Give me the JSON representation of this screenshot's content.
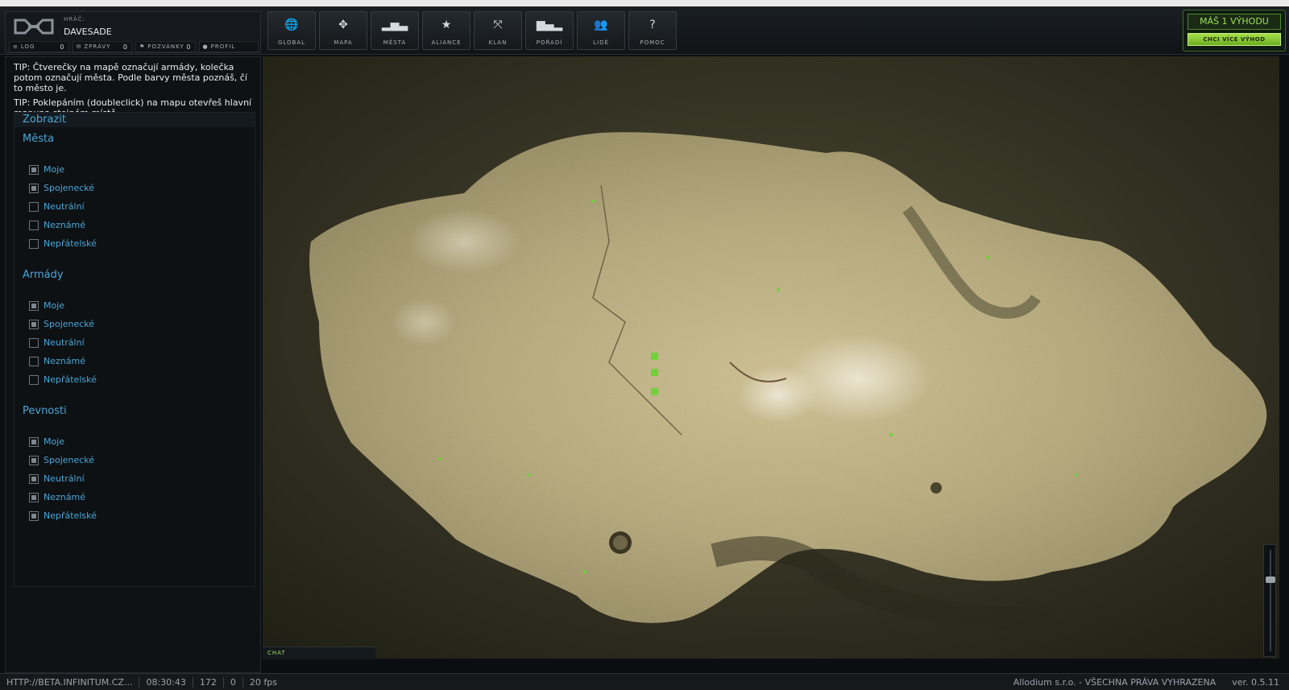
{
  "player": {
    "caption": "HRÁČ:",
    "name": "DAVESADE",
    "links": [
      {
        "label": "LOG",
        "count": "0",
        "icon": "list-icon"
      },
      {
        "label": "ZPRÁVY",
        "count": "0",
        "icon": "mail-icon"
      },
      {
        "label": "POZVÁNKY",
        "count": "0",
        "icon": "invite-icon"
      },
      {
        "label": "PROFIL",
        "count": "",
        "icon": "user-icon"
      }
    ]
  },
  "nav": [
    {
      "label": "GLOBAL",
      "icon": "globe-icon",
      "glyph": "🌐"
    },
    {
      "label": "MAPA",
      "icon": "move-arrows-icon",
      "glyph": "✥"
    },
    {
      "label": "MĚSTA",
      "icon": "buildings-icon",
      "glyph": "▂▅▃"
    },
    {
      "label": "ALIANCE",
      "icon": "star-icon",
      "glyph": "★"
    },
    {
      "label": "KLAN",
      "icon": "expand-icon",
      "glyph": "⤧"
    },
    {
      "label": "POŘADÍ",
      "icon": "ranking-icon",
      "glyph": "▆▄▂"
    },
    {
      "label": "LIDÉ",
      "icon": "people-icon",
      "glyph": "👥"
    },
    {
      "label": "POMOC",
      "icon": "help-icon",
      "glyph": "?"
    }
  ],
  "promo": {
    "title": "MÁŠ 1 VÝHODU",
    "button": "CHCI VÍCE VÝHOD"
  },
  "tips": {
    "tip1": "TIP: Čtverečky na mapě označují armády, kolečka potom označují města. Podle barvy města poznáš, čí to město je.",
    "tip2": "TIP: Poklepáním (doubleclick) na mapu otevřeš hlavní mapuna stejném místě."
  },
  "filters": {
    "title": "Zobrazit",
    "groups": [
      {
        "title": "Města",
        "options": [
          {
            "label": "Moje",
            "checked": true
          },
          {
            "label": "Spojenecké",
            "checked": true
          },
          {
            "label": "Neutrální",
            "checked": false
          },
          {
            "label": "Neznámé",
            "checked": false
          },
          {
            "label": "Nepřátelské",
            "checked": false
          }
        ]
      },
      {
        "title": "Armády",
        "options": [
          {
            "label": "Moje",
            "checked": true
          },
          {
            "label": "Spojenecké",
            "checked": true
          },
          {
            "label": "Neutrální",
            "checked": false
          },
          {
            "label": "Neznámé",
            "checked": false
          },
          {
            "label": "Nepřátelské",
            "checked": false
          }
        ]
      },
      {
        "title": "Pevnosti",
        "options": [
          {
            "label": "Moje",
            "checked": true
          },
          {
            "label": "Spojenecké",
            "checked": true
          },
          {
            "label": "Neutrální",
            "checked": true
          },
          {
            "label": "Neznámé",
            "checked": true
          },
          {
            "label": "Nepřátelské",
            "checked": true
          }
        ]
      }
    ]
  },
  "chat": {
    "label": "CHAT"
  },
  "zoom": {
    "level": 0.72
  },
  "status": {
    "url": "HTTP://BETA.INFINITUM.CZ...",
    "time": "08:30:43",
    "count": "172",
    "zero": "0",
    "fps": "20 fps",
    "copyright": "Allodium s.r.o. - VŠECHNA PRÁVA VYHRAZENA",
    "version": "ver. 0.5.11"
  },
  "colors": {
    "accent": "#4aa6d6",
    "promo_green": "#9ee05a",
    "map_land": "#b3a778",
    "map_dark": "#3a3826"
  }
}
